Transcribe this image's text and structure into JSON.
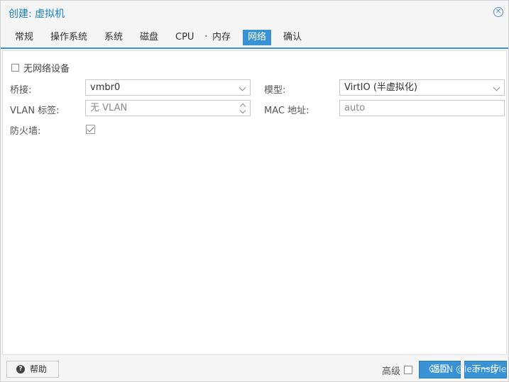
{
  "window": {
    "title": "创建: 虚拟机"
  },
  "tabs": [
    {
      "label": "常规"
    },
    {
      "label": "操作系统"
    },
    {
      "label": "系统"
    },
    {
      "label": "磁盘"
    },
    {
      "label": "CPU"
    },
    {
      "label": "内存"
    },
    {
      "label": "网络",
      "active": true
    },
    {
      "label": "确认"
    }
  ],
  "form": {
    "no_network_label": "无网络设备",
    "no_network_checked": false,
    "bridge": {
      "label": "桥接:",
      "value": "vmbr0"
    },
    "vlan": {
      "label": "VLAN 标签:",
      "placeholder": "无 VLAN"
    },
    "firewall": {
      "label": "防火墙:",
      "checked": true
    },
    "model": {
      "label": "模型:",
      "value": "VirtIO (半虚拟化)"
    },
    "mac": {
      "label": "MAC 地址:",
      "placeholder": "auto"
    }
  },
  "footer": {
    "help_label": "帮助",
    "advanced_label": "高级",
    "advanced_checked": false,
    "back_label": "返回",
    "next_label": "下一步"
  },
  "watermark": "CSDN @learnstyle",
  "colors": {
    "accent": "#3892d4",
    "title": "#157fcc"
  }
}
